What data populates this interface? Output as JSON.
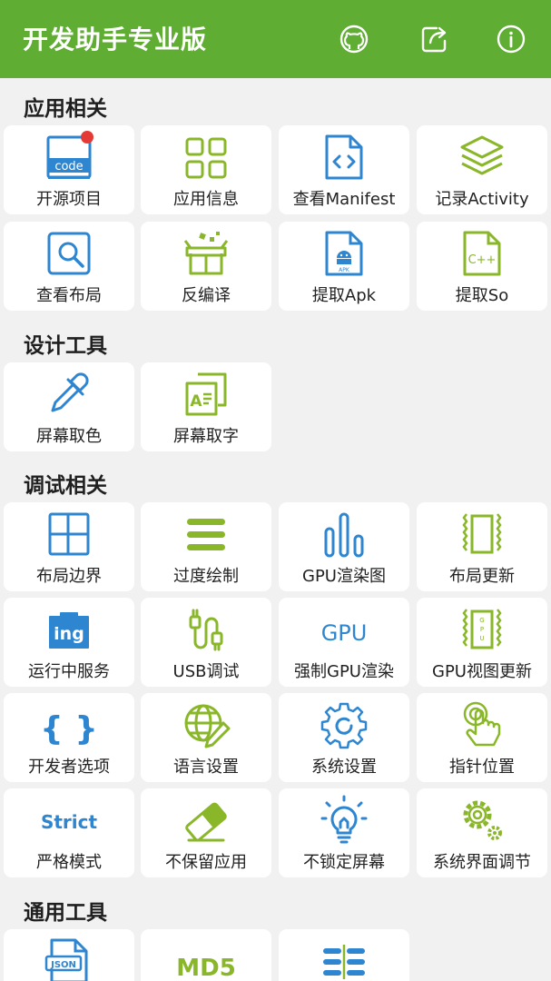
{
  "header": {
    "title": "开发助手专业版",
    "actions": [
      "github-icon",
      "share-icon",
      "info-icon"
    ]
  },
  "colors": {
    "primary": "#5fad32",
    "accent_blue": "#2e86d1",
    "accent_green": "#8ab72a",
    "badge": "#e53935"
  },
  "sections": [
    {
      "title": "应用相关",
      "items": [
        {
          "label": "开源项目",
          "icon": "code-icon",
          "badge": true
        },
        {
          "label": "应用信息",
          "icon": "grid-apps-icon"
        },
        {
          "label": "查看Manifest",
          "icon": "code-file-icon"
        },
        {
          "label": "记录Activity",
          "icon": "layers-icon"
        },
        {
          "label": "查看布局",
          "icon": "search-layout-icon"
        },
        {
          "label": "反编译",
          "icon": "open-box-icon"
        },
        {
          "label": "提取Apk",
          "icon": "apk-file-icon"
        },
        {
          "label": "提取So",
          "icon": "cpp-file-icon"
        }
      ]
    },
    {
      "title": "设计工具",
      "items": [
        {
          "label": "屏幕取色",
          "icon": "eyedropper-icon"
        },
        {
          "label": "屏幕取字",
          "icon": "text-copy-icon"
        }
      ]
    },
    {
      "title": "调试相关",
      "items": [
        {
          "label": "布局边界",
          "icon": "layout-bounds-icon"
        },
        {
          "label": "过度绘制",
          "icon": "overdraw-icon"
        },
        {
          "label": "GPU渲染图",
          "icon": "bar-chart-icon"
        },
        {
          "label": "布局更新",
          "icon": "layout-update-icon"
        },
        {
          "label": "运行中服务",
          "icon": "ing-icon",
          "icon_text": "ing"
        },
        {
          "label": "USB调试",
          "icon": "usb-cable-icon"
        },
        {
          "label": "强制GPU渲染",
          "icon": "gpu-text-icon",
          "icon_text": "GPU"
        },
        {
          "label": "GPU视图更新",
          "icon": "gpu-view-update-icon"
        },
        {
          "label": "开发者选项",
          "icon": "braces-icon",
          "icon_text": "{ }"
        },
        {
          "label": "语言设置",
          "icon": "globe-pen-icon"
        },
        {
          "label": "系统设置",
          "icon": "gear-icon"
        },
        {
          "label": "指针位置",
          "icon": "pointer-hand-icon"
        },
        {
          "label": "严格模式",
          "icon": "strict-text-icon",
          "icon_text": "Strict"
        },
        {
          "label": "不保留应用",
          "icon": "eraser-icon"
        },
        {
          "label": "不锁定屏幕",
          "icon": "lightbulb-icon"
        },
        {
          "label": "系统界面调节",
          "icon": "gears-icon"
        }
      ]
    },
    {
      "title": "通用工具",
      "items": [
        {
          "label": "",
          "icon": "json-file-icon",
          "icon_text": "JSON"
        },
        {
          "label": "",
          "icon": "md5-text-icon",
          "icon_text": "MD5"
        },
        {
          "label": "",
          "icon": "list-lines-icon"
        }
      ]
    }
  ]
}
